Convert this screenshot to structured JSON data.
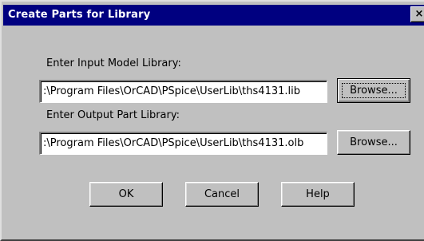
{
  "window": {
    "title": "Create Parts for Library",
    "close_glyph": "×"
  },
  "input_library": {
    "label": "Enter Input Model Library:",
    "value": ":\\Program Files\\OrCAD\\PSpice\\UserLib\\ths4131.lib",
    "browse_label": "Browse..."
  },
  "output_library": {
    "label": "Enter Output Part Library:",
    "value": ":\\Program Files\\OrCAD\\PSpice\\UserLib\\ths4131.olb",
    "browse_label": "Browse..."
  },
  "buttons": {
    "ok": "OK",
    "cancel": "Cancel",
    "help": "Help"
  }
}
